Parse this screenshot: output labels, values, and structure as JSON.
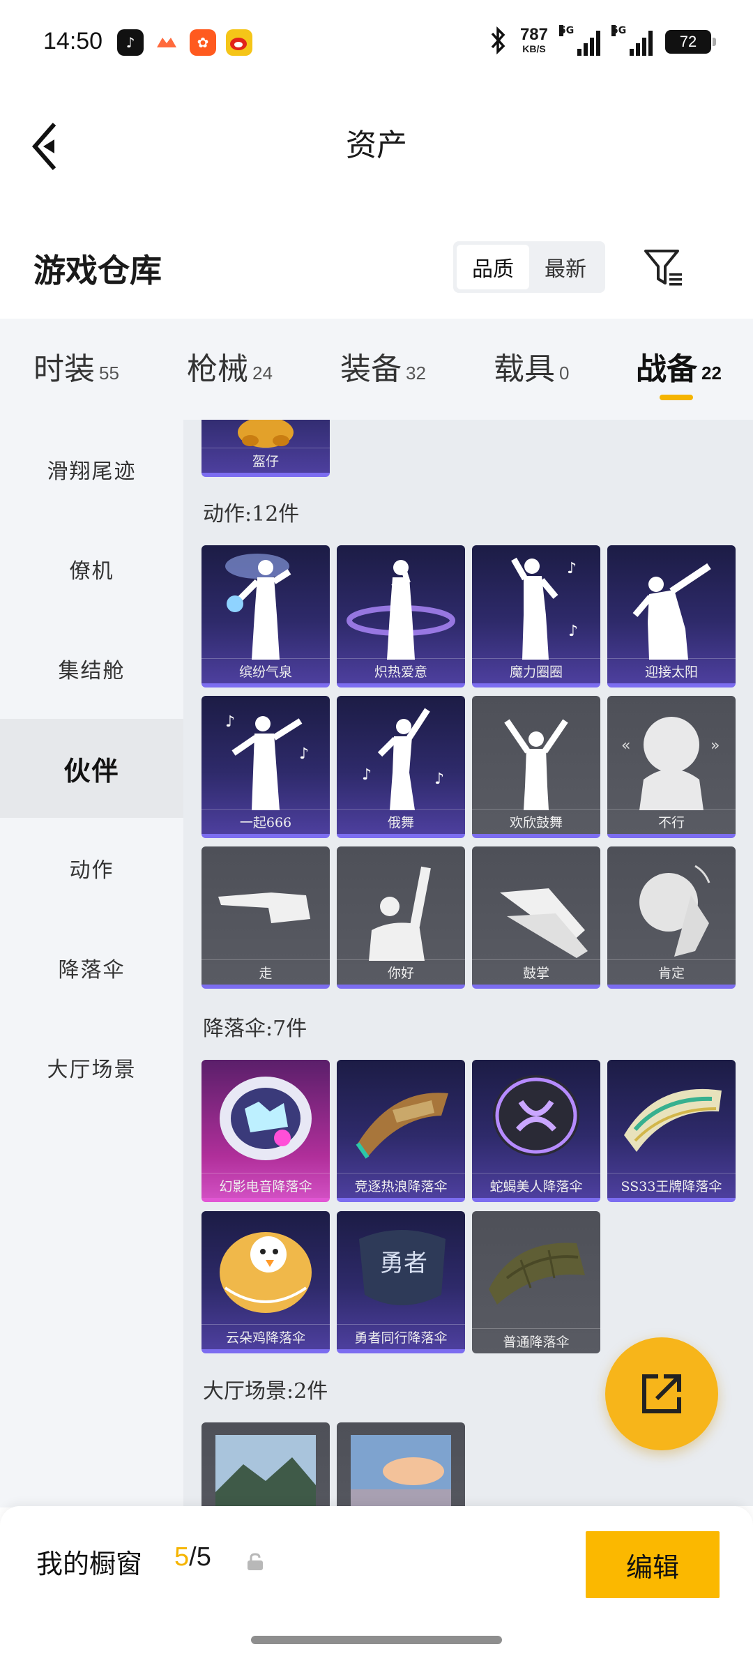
{
  "status_bar": {
    "time": "14:50",
    "speed_value": "787",
    "speed_unit": "KB/S",
    "signal1_tag": "5G",
    "signal2_tag": "5G",
    "battery": "72"
  },
  "nav": {
    "title": "资产"
  },
  "warehouse": {
    "title": "游戏仓库",
    "sort": {
      "quality": "品质",
      "newest": "最新"
    }
  },
  "tabs": [
    {
      "label": "时装",
      "count": "55"
    },
    {
      "label": "枪械",
      "count": "24"
    },
    {
      "label": "装备",
      "count": "32"
    },
    {
      "label": "载具",
      "count": "0"
    },
    {
      "label": "战备",
      "count": "22"
    }
  ],
  "sidebar": {
    "items": [
      "滑翔尾迹",
      "僚机",
      "集结舱",
      "伙伴",
      "动作",
      "降落伞",
      "大厅场景"
    ]
  },
  "content": {
    "partner_card": "盔仔",
    "actions_title": "动作:12件",
    "actions": [
      "缤纷气泉",
      "炽热爱意",
      "魔力圈圈",
      "迎接太阳",
      "一起666",
      "俄舞",
      "欢欣鼓舞",
      "不行",
      "走",
      "你好",
      "鼓掌",
      "肯定"
    ],
    "parachutes_title": "降落伞:7件",
    "parachutes": [
      "幻影电音降落伞",
      "竞逐热浪降落伞",
      "蛇蝎美人降落伞",
      "SS33王牌降落伞",
      "云朵鸡降落伞",
      "勇者同行降落伞",
      "普通降落伞"
    ],
    "scenes_title": "大厅场景:2件"
  },
  "bottom": {
    "label": "我的橱窗",
    "current": "5",
    "total": "/5",
    "edit": "编辑"
  },
  "colors": {
    "accent": "#f5b400",
    "card_purple": "#2e2a6a",
    "card_gray": "#595b63",
    "card_pink": "#b02f9a",
    "rarity_bar": "#7c6df0"
  }
}
